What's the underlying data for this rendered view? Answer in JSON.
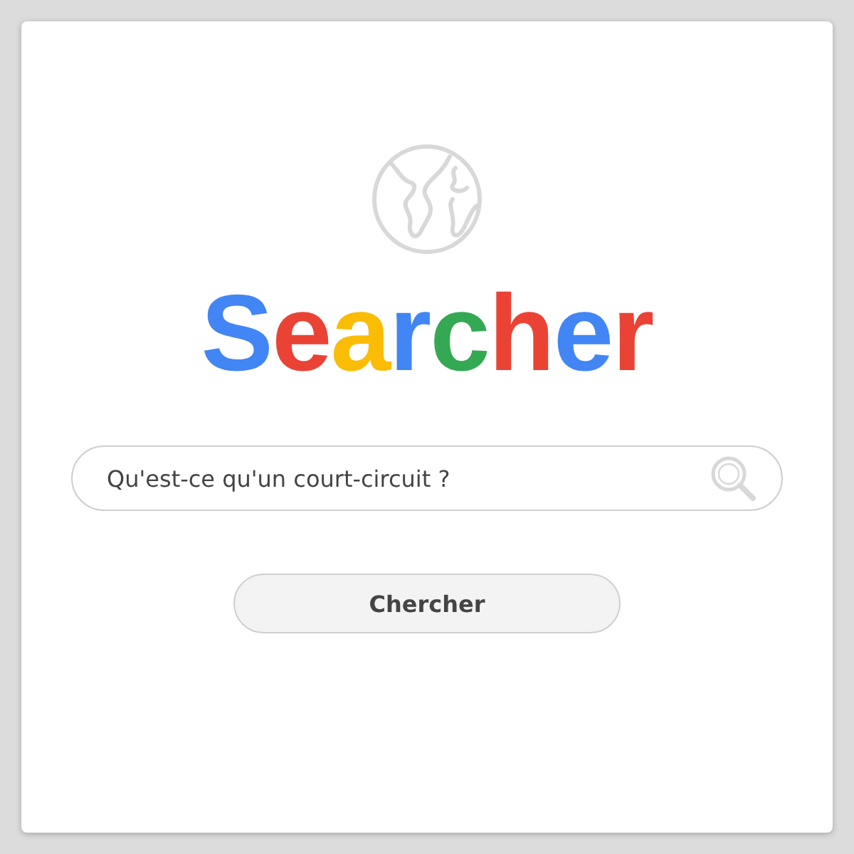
{
  "logo": {
    "letters": [
      {
        "text": "S",
        "color": "#4285f4"
      },
      {
        "text": "e",
        "color": "#ea4335"
      },
      {
        "text": "a",
        "color": "#fbbc05"
      },
      {
        "text": "r",
        "color": "#4285f4"
      },
      {
        "text": "c",
        "color": "#34a853"
      },
      {
        "text": "h",
        "color": "#ea4335"
      },
      {
        "text": "e",
        "color": "#4285f4"
      },
      {
        "text": "r",
        "color": "#ea4335"
      }
    ]
  },
  "search": {
    "value": "Qu'est-ce qu'un court-circuit ?"
  },
  "button": {
    "label": "Chercher"
  }
}
